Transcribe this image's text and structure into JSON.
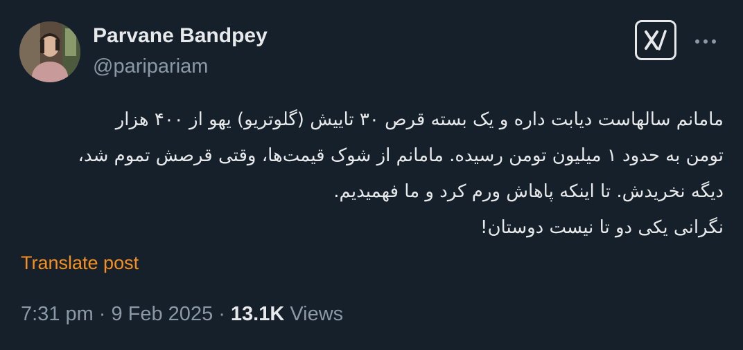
{
  "author": {
    "display_name": "Parvane Bandpey",
    "handle": "@paripariam",
    "avatar_icon": "profile-photo"
  },
  "header_actions": {
    "grok_icon": "grok-logo-icon",
    "more_icon": "more-options-icon"
  },
  "post": {
    "lines": [
      "مامانم سالهاست دیابت داره و یک بسته قرص ۳۰ تاییش (گلوتریو) یهو از ۴۰۰ هزار",
      "تومن به حدود ۱ میلیون تومن رسیده. مامانم از شوک قیمت‌ها، وقتی قرصش تموم شد،",
      "دیگه نخریدش. تا اینکه پاهاش ورم کرد و ما فهمیدیم.",
      "نگرانی یکی دو تا نیست دوستان!"
    ],
    "translate_label": "Translate post",
    "time": "7:31 pm",
    "date": "9 Feb 2025",
    "separator": "·",
    "views_count": "13.1K",
    "views_label": "Views"
  },
  "colors": {
    "background": "#15202b",
    "text_primary": "#e7e9ea",
    "text_secondary": "#8b98a5",
    "translate_link": "#f7901e"
  }
}
